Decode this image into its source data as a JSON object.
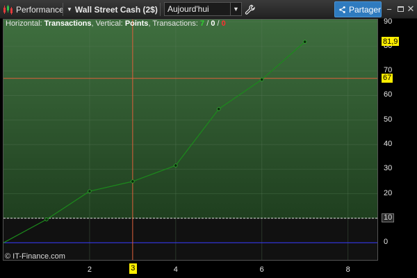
{
  "toolbar": {
    "performance_label": "Performance",
    "instrument_label": "Wall Street Cash (2$)",
    "period_value": "Aujourd'hui",
    "share_label": "Partager"
  },
  "chart": {
    "legend": {
      "horizontal_prefix": "Horizontal:",
      "horizontal_value": "Transactions",
      "vertical_prefix": ", Vertical:",
      "vertical_value": "Points",
      "transactions_prefix": ", Transactions:",
      "wins": "7",
      "sep1": "/",
      "neutral": "0",
      "sep2": "/",
      "losses": "0"
    },
    "credit": "© IT-Finance.com",
    "y_ticks": [
      "90",
      "80",
      "70",
      "60",
      "50",
      "40",
      "30",
      "20",
      "10",
      "0"
    ],
    "x_ticks": [
      "2",
      "4",
      "6",
      "8"
    ],
    "tags": {
      "last": "81,9",
      "crosshair_y": "67",
      "dashed": "10",
      "crosshair_x": "3"
    },
    "colors": {
      "green_top": "#3f6f3f",
      "green_bottom": "#1f3f1f",
      "line": "#1c8a1c",
      "crosshair": "#e0603c",
      "zero": "#3333ff",
      "tag_yellow": "#ffee00"
    }
  },
  "chart_data": {
    "type": "line",
    "title": "",
    "xlabel": "Transactions",
    "ylabel": "Points",
    "x": [
      0,
      1,
      2,
      3,
      4,
      5,
      6,
      7
    ],
    "series": [
      {
        "values": [
          0,
          9.5,
          21,
          25,
          31.5,
          54.5,
          66.5,
          81.9
        ]
      }
    ],
    "xlim": [
      0,
      8.7
    ],
    "ylim": [
      -7,
      91
    ],
    "grid": true,
    "reference_lines": {
      "dashed_y": 10,
      "zero_y": 0,
      "crosshair_x": 3,
      "crosshair_y": 67
    }
  }
}
